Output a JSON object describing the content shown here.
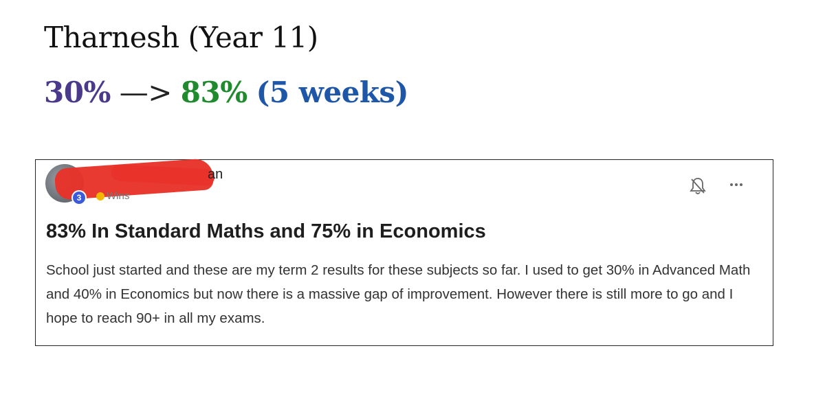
{
  "heading": {
    "title": "Tharnesh (Year 11)"
  },
  "progress": {
    "before": "30%",
    "arrow": "—>",
    "after": "83%",
    "duration": "(5 weeks)"
  },
  "post": {
    "author_suffix": "an",
    "level": "3",
    "wins_label": "Wins",
    "title": "83% In Standard Maths and 75% in Economics",
    "body": "School just started and these are my term 2 results for these subjects so far. I used to get 30% in Advanced Math and 40% in Economics but now there is a massive gap of improvement. However there is still more to go and I hope to reach 90+ in all my exams."
  },
  "colors": {
    "before": "#4b3a8c",
    "after": "#1f8a2e",
    "duration": "#1f57a8",
    "redaction": "#e8322a"
  }
}
